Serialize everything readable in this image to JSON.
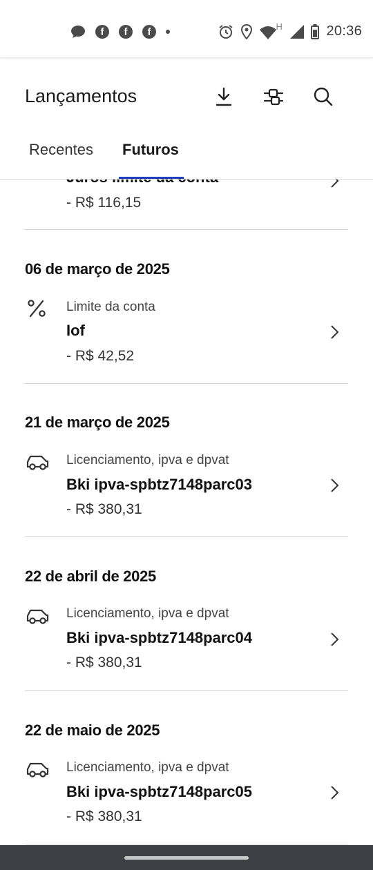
{
  "status_bar": {
    "time": "20:36",
    "network_indicator": "H",
    "left_icons": [
      "chat-bubble-icon",
      "facebook-icon",
      "facebook-icon",
      "facebook-icon",
      "notification-dot-icon"
    ],
    "right_icons": [
      "alarm-icon",
      "location-icon",
      "wifi-icon",
      "signal-icon",
      "battery-icon"
    ]
  },
  "header": {
    "title": "Lançamentos",
    "actions": [
      "download-icon",
      "filter-icon",
      "search-icon"
    ]
  },
  "tabs": [
    {
      "label": "Recentes",
      "active": false
    },
    {
      "label": "Futuros",
      "active": true
    }
  ],
  "accent_color": "#1d3fbf",
  "partial_item": {
    "name": "Juros limite da conta",
    "amount": "- R$ 116,15"
  },
  "groups": [
    {
      "date": "06 de março de 2025",
      "icon": "percent-icon",
      "category": "Limite da conta",
      "name": "Iof",
      "amount": "- R$ 42,52"
    },
    {
      "date": "21 de março de 2025",
      "icon": "car-icon",
      "category": "Licenciamento, ipva e dpvat",
      "name": "Bki ipva-spbtz7148parc03",
      "amount": "- R$ 380,31"
    },
    {
      "date": "22 de abril de 2025",
      "icon": "car-icon",
      "category": "Licenciamento, ipva e dpvat",
      "name": "Bki ipva-spbtz7148parc04",
      "amount": "- R$ 380,31"
    },
    {
      "date": "22 de maio de 2025",
      "icon": "car-icon",
      "category": "Licenciamento, ipva e dpvat",
      "name": "Bki ipva-spbtz7148parc05",
      "amount": "- R$ 380,31"
    }
  ]
}
